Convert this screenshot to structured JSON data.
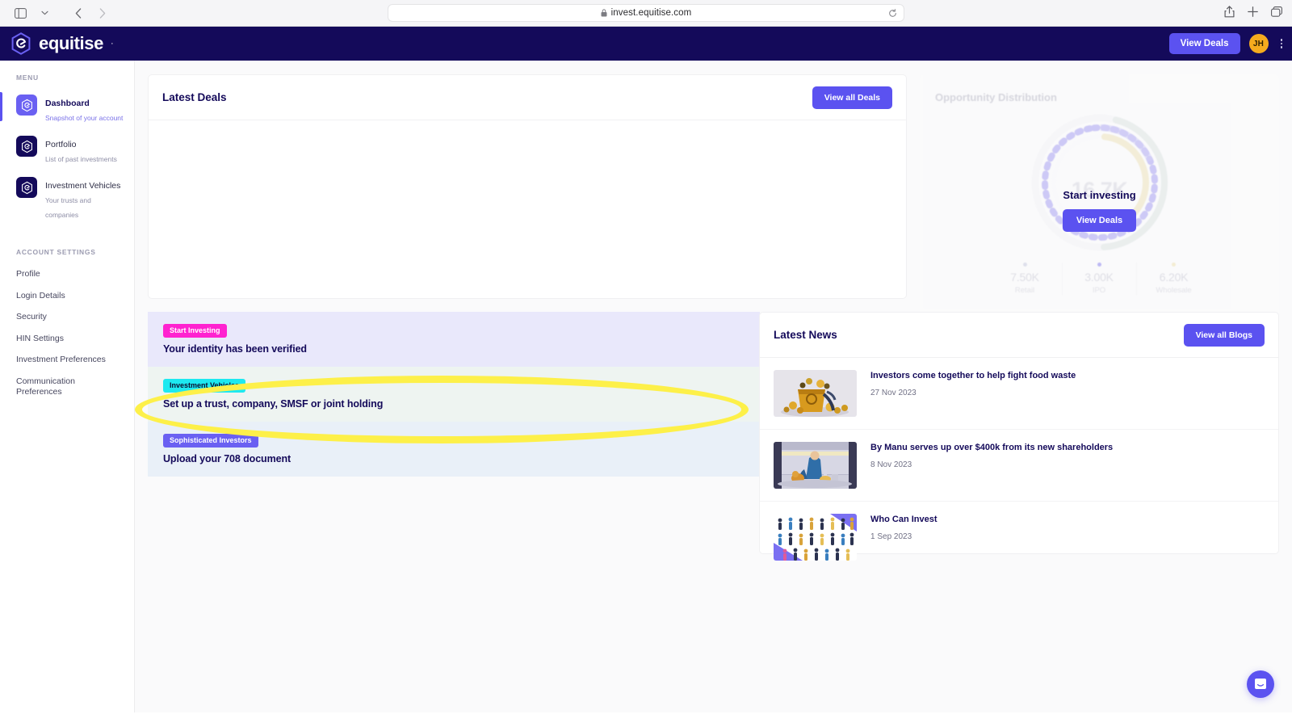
{
  "browser": {
    "url": "invest.equitise.com",
    "lock_icon": "lock-icon",
    "sidebar_toggle_icon": "sidebar-toggle-icon",
    "tab_overview_icon": "chevron-down-icon",
    "back_icon": "back-arrow-icon",
    "forward_icon": "forward-arrow-icon",
    "reload_icon": "reload-icon",
    "share_icon": "share-icon",
    "new_tab_icon": "plus-icon",
    "tabs_icon": "tabs-icon"
  },
  "header": {
    "brand": "equitise",
    "brand_trademark": "·",
    "view_deals_label": "View Deals",
    "avatar_initials": "JH",
    "kebab_icon": "kebab-menu-icon"
  },
  "sidebar": {
    "menu_caption": "MENU",
    "settings_caption": "ACCOUNT SETTINGS",
    "items": [
      {
        "label": "Dashboard",
        "sub": "Snapshot of your account",
        "active": true
      },
      {
        "label": "Portfolio",
        "sub": "List of past investments",
        "active": false
      },
      {
        "label": "Investment Vehicles",
        "sub": "Your trusts and companies",
        "active": false
      }
    ],
    "settings": [
      "Profile",
      "Login Details",
      "Security",
      "HIN Settings",
      "Investment Preferences",
      "Communication Preferences"
    ]
  },
  "deals": {
    "title": "Latest Deals",
    "view_all_label": "View all Deals"
  },
  "opportunity": {
    "title": "Opportunity Distribution",
    "center_value": "16.7K",
    "overlay_title": "Start investing",
    "overlay_button": "View Deals"
  },
  "chart_data": {
    "type": "pie",
    "title": "Opportunity Distribution",
    "center_total": "16.7K",
    "center_total_value": 16700,
    "categories": [
      "Retail",
      "IPO",
      "Wholesale"
    ],
    "value_labels": [
      "7.50K",
      "3.00K",
      "6.20K"
    ],
    "values": [
      7500,
      3000,
      6200
    ],
    "colors": [
      "#c9cce0",
      "#8d86ef",
      "#efe3b4"
    ],
    "legend_position": "bottom",
    "grid": false
  },
  "actions": [
    {
      "tag": "Start Investing",
      "tag_color": "#ff22d0",
      "title": "Your identity has been verified",
      "bg": "#e9e8fb"
    },
    {
      "tag": "Investment Vehicles",
      "tag_color": "#1de9f0",
      "title": "Set up a trust, company, SMSF or joint holding",
      "bg": "#eef4f1"
    },
    {
      "tag": "Sophisticated Investors",
      "tag_color": "#6a60f2",
      "title": "Upload your 708 document",
      "bg": "#e9f0f8"
    }
  ],
  "news": {
    "title": "Latest News",
    "view_all_label": "View all Blogs",
    "items": [
      {
        "title": "Investors come together to help fight food waste",
        "date": "27 Nov 2023",
        "thumb": "food-waste-thumbnail"
      },
      {
        "title": "By Manu serves up over $400k from its new shareholders",
        "date": "8 Nov 2023",
        "thumb": "chef-thumbnail"
      },
      {
        "title": "Who Can Invest",
        "date": "1 Sep 2023",
        "thumb": "crowd-people-thumbnail"
      }
    ]
  },
  "chat": {
    "icon": "chat-bubble-icon"
  },
  "annotation": {
    "type": "highlight-ellipse",
    "color": "#fdf049",
    "target": "Set up a trust, company, SMSF or joint holding"
  }
}
